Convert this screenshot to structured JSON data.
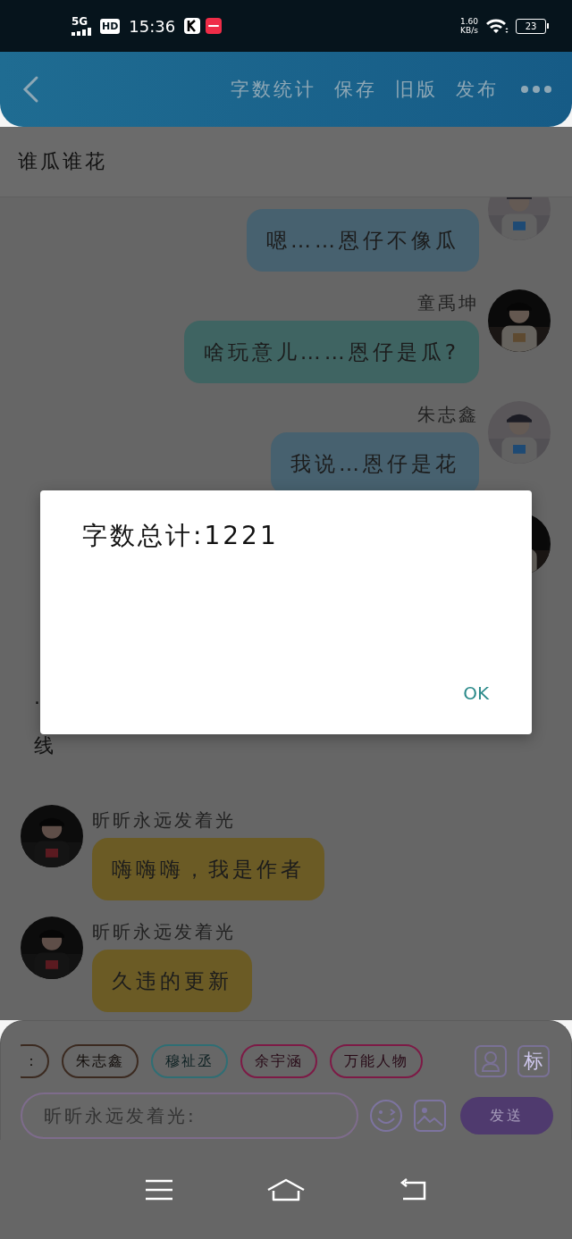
{
  "status_bar": {
    "network": "5G",
    "hd": "HD",
    "time": "15:36",
    "speed": "1.60",
    "speed_unit": "KB/s",
    "battery": "23"
  },
  "header": {
    "actions": [
      "字数统计",
      "保存",
      "旧版",
      "发布"
    ]
  },
  "title": "谁瓜谁花",
  "messages": [
    {
      "kind": "right",
      "text": "嗯……恩仔不像瓜",
      "color": "#47616f"
    },
    {
      "kind": "right",
      "name": "童禹坤",
      "text": "啥玩意儿……恩仔是瓜?",
      "color": "#3f6462"
    },
    {
      "kind": "right",
      "name": "朱志鑫",
      "text": "我说…恩仔是花",
      "color": "#47616f"
    },
    {
      "kind": "narration",
      "text": "·"
    },
    {
      "kind": "narration",
      "text": "线"
    },
    {
      "kind": "left",
      "name": "昕昕永远发着光",
      "text": "嗨嗨嗨，我是作者",
      "color": "#6b5b25"
    },
    {
      "kind": "left",
      "name": "昕昕永远发着光",
      "text": "久违的更新",
      "color": "#6b5b25"
    }
  ],
  "input_panel": {
    "tags": [
      {
        "label": "：",
        "color": "#3b2a20"
      },
      {
        "label": "朱志鑫",
        "color": "#3b2a20"
      },
      {
        "label": "穆祉丞",
        "color": "#2f6e74"
      },
      {
        "label": "余宇涵",
        "color": "#7d1a46"
      },
      {
        "label": "万能人物",
        "color": "#7d1a46"
      }
    ],
    "tag_button": "标",
    "placeholder": "昕昕永远发着光:",
    "send": "发送"
  },
  "dialog": {
    "message": "字数总计:1221",
    "ok": "OK"
  }
}
